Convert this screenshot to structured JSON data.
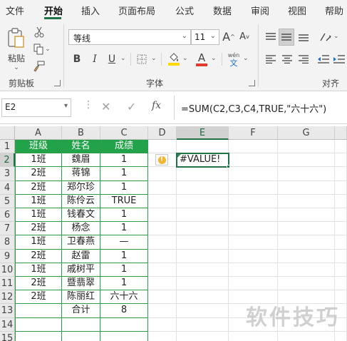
{
  "menu": {
    "tabs": [
      "文件",
      "开始",
      "插入",
      "页面布局",
      "公式",
      "数据",
      "审阅",
      "视图",
      "帮助"
    ],
    "active": "开始"
  },
  "ribbon": {
    "paste_label": "粘贴",
    "clipboard_group": "剪贴板",
    "font_group": "字体",
    "align_group": "对齐方",
    "font_name": "等线",
    "font_size": "11",
    "grow_font": "A",
    "shrink_font": "A",
    "bold": "B",
    "italic": "I",
    "underline": "U",
    "font_color_glyph": "A",
    "phonetic_top": "wén",
    "phonetic_bottom": "文",
    "colors": {
      "fill": "#ffd700",
      "font": "#e03a2f",
      "accent": "#217346"
    }
  },
  "formula_bar": {
    "name_box": "E2",
    "cancel": "✕",
    "enter": "✓",
    "fx": "fx",
    "formula": "=SUM(C2,C3,C4,TRUE,\"六十六\")"
  },
  "sheet": {
    "columns": [
      "A",
      "B",
      "C",
      "D",
      "E",
      "F",
      "G"
    ],
    "selected_column": "E",
    "selected_row": "2",
    "rows": [
      "1",
      "2",
      "3",
      "4",
      "5",
      "6",
      "7",
      "8",
      "9",
      "10",
      "11",
      "12",
      "13",
      "14",
      "15"
    ],
    "header": [
      "班级",
      "姓名",
      "成绩"
    ],
    "data": [
      [
        "1班",
        "魏眉",
        "1"
      ],
      [
        "2班",
        "蒋锦",
        "1"
      ],
      [
        "2班",
        "郑尔珍",
        "1"
      ],
      [
        "1班",
        "陈伶云",
        "TRUE"
      ],
      [
        "1班",
        "钱春文",
        "1"
      ],
      [
        "2班",
        "杨念",
        "1"
      ],
      [
        "1班",
        "卫春燕",
        "—"
      ],
      [
        "2班",
        "赵雷",
        "1"
      ],
      [
        "1班",
        "戚树平",
        "1"
      ],
      [
        "2班",
        "暨翡翠",
        "1"
      ],
      [
        "2班",
        "陈丽红",
        "六十六"
      ],
      [
        "",
        "合计",
        "8"
      ],
      [
        "",
        "",
        ""
      ],
      [
        "",
        "",
        ""
      ]
    ],
    "e2_value": "#VALUE!",
    "warning_glyph": "!"
  },
  "watermark": "软件技巧"
}
